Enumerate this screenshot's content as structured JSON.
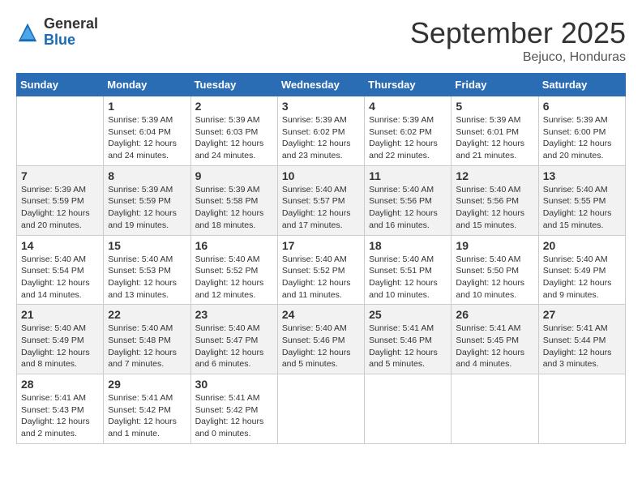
{
  "logo": {
    "general": "General",
    "blue": "Blue"
  },
  "title": "September 2025",
  "location": "Bejuco, Honduras",
  "days_of_week": [
    "Sunday",
    "Monday",
    "Tuesday",
    "Wednesday",
    "Thursday",
    "Friday",
    "Saturday"
  ],
  "weeks": [
    [
      {
        "day": "",
        "info": ""
      },
      {
        "day": "1",
        "info": "Sunrise: 5:39 AM\nSunset: 6:04 PM\nDaylight: 12 hours\nand 24 minutes."
      },
      {
        "day": "2",
        "info": "Sunrise: 5:39 AM\nSunset: 6:03 PM\nDaylight: 12 hours\nand 24 minutes."
      },
      {
        "day": "3",
        "info": "Sunrise: 5:39 AM\nSunset: 6:02 PM\nDaylight: 12 hours\nand 23 minutes."
      },
      {
        "day": "4",
        "info": "Sunrise: 5:39 AM\nSunset: 6:02 PM\nDaylight: 12 hours\nand 22 minutes."
      },
      {
        "day": "5",
        "info": "Sunrise: 5:39 AM\nSunset: 6:01 PM\nDaylight: 12 hours\nand 21 minutes."
      },
      {
        "day": "6",
        "info": "Sunrise: 5:39 AM\nSunset: 6:00 PM\nDaylight: 12 hours\nand 20 minutes."
      }
    ],
    [
      {
        "day": "7",
        "info": "Sunrise: 5:39 AM\nSunset: 5:59 PM\nDaylight: 12 hours\nand 20 minutes."
      },
      {
        "day": "8",
        "info": "Sunrise: 5:39 AM\nSunset: 5:59 PM\nDaylight: 12 hours\nand 19 minutes."
      },
      {
        "day": "9",
        "info": "Sunrise: 5:39 AM\nSunset: 5:58 PM\nDaylight: 12 hours\nand 18 minutes."
      },
      {
        "day": "10",
        "info": "Sunrise: 5:40 AM\nSunset: 5:57 PM\nDaylight: 12 hours\nand 17 minutes."
      },
      {
        "day": "11",
        "info": "Sunrise: 5:40 AM\nSunset: 5:56 PM\nDaylight: 12 hours\nand 16 minutes."
      },
      {
        "day": "12",
        "info": "Sunrise: 5:40 AM\nSunset: 5:56 PM\nDaylight: 12 hours\nand 15 minutes."
      },
      {
        "day": "13",
        "info": "Sunrise: 5:40 AM\nSunset: 5:55 PM\nDaylight: 12 hours\nand 15 minutes."
      }
    ],
    [
      {
        "day": "14",
        "info": "Sunrise: 5:40 AM\nSunset: 5:54 PM\nDaylight: 12 hours\nand 14 minutes."
      },
      {
        "day": "15",
        "info": "Sunrise: 5:40 AM\nSunset: 5:53 PM\nDaylight: 12 hours\nand 13 minutes."
      },
      {
        "day": "16",
        "info": "Sunrise: 5:40 AM\nSunset: 5:52 PM\nDaylight: 12 hours\nand 12 minutes."
      },
      {
        "day": "17",
        "info": "Sunrise: 5:40 AM\nSunset: 5:52 PM\nDaylight: 12 hours\nand 11 minutes."
      },
      {
        "day": "18",
        "info": "Sunrise: 5:40 AM\nSunset: 5:51 PM\nDaylight: 12 hours\nand 10 minutes."
      },
      {
        "day": "19",
        "info": "Sunrise: 5:40 AM\nSunset: 5:50 PM\nDaylight: 12 hours\nand 10 minutes."
      },
      {
        "day": "20",
        "info": "Sunrise: 5:40 AM\nSunset: 5:49 PM\nDaylight: 12 hours\nand 9 minutes."
      }
    ],
    [
      {
        "day": "21",
        "info": "Sunrise: 5:40 AM\nSunset: 5:49 PM\nDaylight: 12 hours\nand 8 minutes."
      },
      {
        "day": "22",
        "info": "Sunrise: 5:40 AM\nSunset: 5:48 PM\nDaylight: 12 hours\nand 7 minutes."
      },
      {
        "day": "23",
        "info": "Sunrise: 5:40 AM\nSunset: 5:47 PM\nDaylight: 12 hours\nand 6 minutes."
      },
      {
        "day": "24",
        "info": "Sunrise: 5:40 AM\nSunset: 5:46 PM\nDaylight: 12 hours\nand 5 minutes."
      },
      {
        "day": "25",
        "info": "Sunrise: 5:41 AM\nSunset: 5:46 PM\nDaylight: 12 hours\nand 5 minutes."
      },
      {
        "day": "26",
        "info": "Sunrise: 5:41 AM\nSunset: 5:45 PM\nDaylight: 12 hours\nand 4 minutes."
      },
      {
        "day": "27",
        "info": "Sunrise: 5:41 AM\nSunset: 5:44 PM\nDaylight: 12 hours\nand 3 minutes."
      }
    ],
    [
      {
        "day": "28",
        "info": "Sunrise: 5:41 AM\nSunset: 5:43 PM\nDaylight: 12 hours\nand 2 minutes."
      },
      {
        "day": "29",
        "info": "Sunrise: 5:41 AM\nSunset: 5:42 PM\nDaylight: 12 hours\nand 1 minute."
      },
      {
        "day": "30",
        "info": "Sunrise: 5:41 AM\nSunset: 5:42 PM\nDaylight: 12 hours\nand 0 minutes."
      },
      {
        "day": "",
        "info": ""
      },
      {
        "day": "",
        "info": ""
      },
      {
        "day": "",
        "info": ""
      },
      {
        "day": "",
        "info": ""
      }
    ]
  ]
}
